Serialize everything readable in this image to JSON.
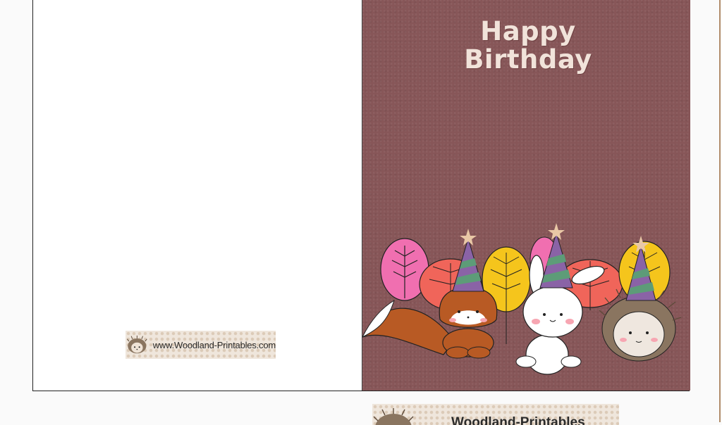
{
  "card": {
    "greeting_line1": "Happy",
    "greeting_line2": "Birthday",
    "cover_color": "#875658",
    "greeting_color": "#f1e3da"
  },
  "watermark": {
    "text": "www.Woodland-Printables.com",
    "icon": "hedgehog-icon"
  },
  "watermark_bottom": {
    "text": "Woodland-Printables",
    "icon": "hedgehog-icon"
  },
  "illustration": {
    "characters": [
      "fox",
      "bunny",
      "hedgehog"
    ],
    "accessories": [
      "party-hat",
      "party-hat",
      "party-hat"
    ],
    "trees": [
      "pink-tree",
      "red-tree",
      "yellow-tree",
      "pink-tree",
      "red-tree",
      "yellow-tree"
    ],
    "colors": {
      "pink": "#f06fb0",
      "red": "#f0655a",
      "yellow": "#f5c51c",
      "hat_purple": "#8a63a6",
      "hat_green": "#5d9c78",
      "fox": "#b85a24"
    }
  }
}
